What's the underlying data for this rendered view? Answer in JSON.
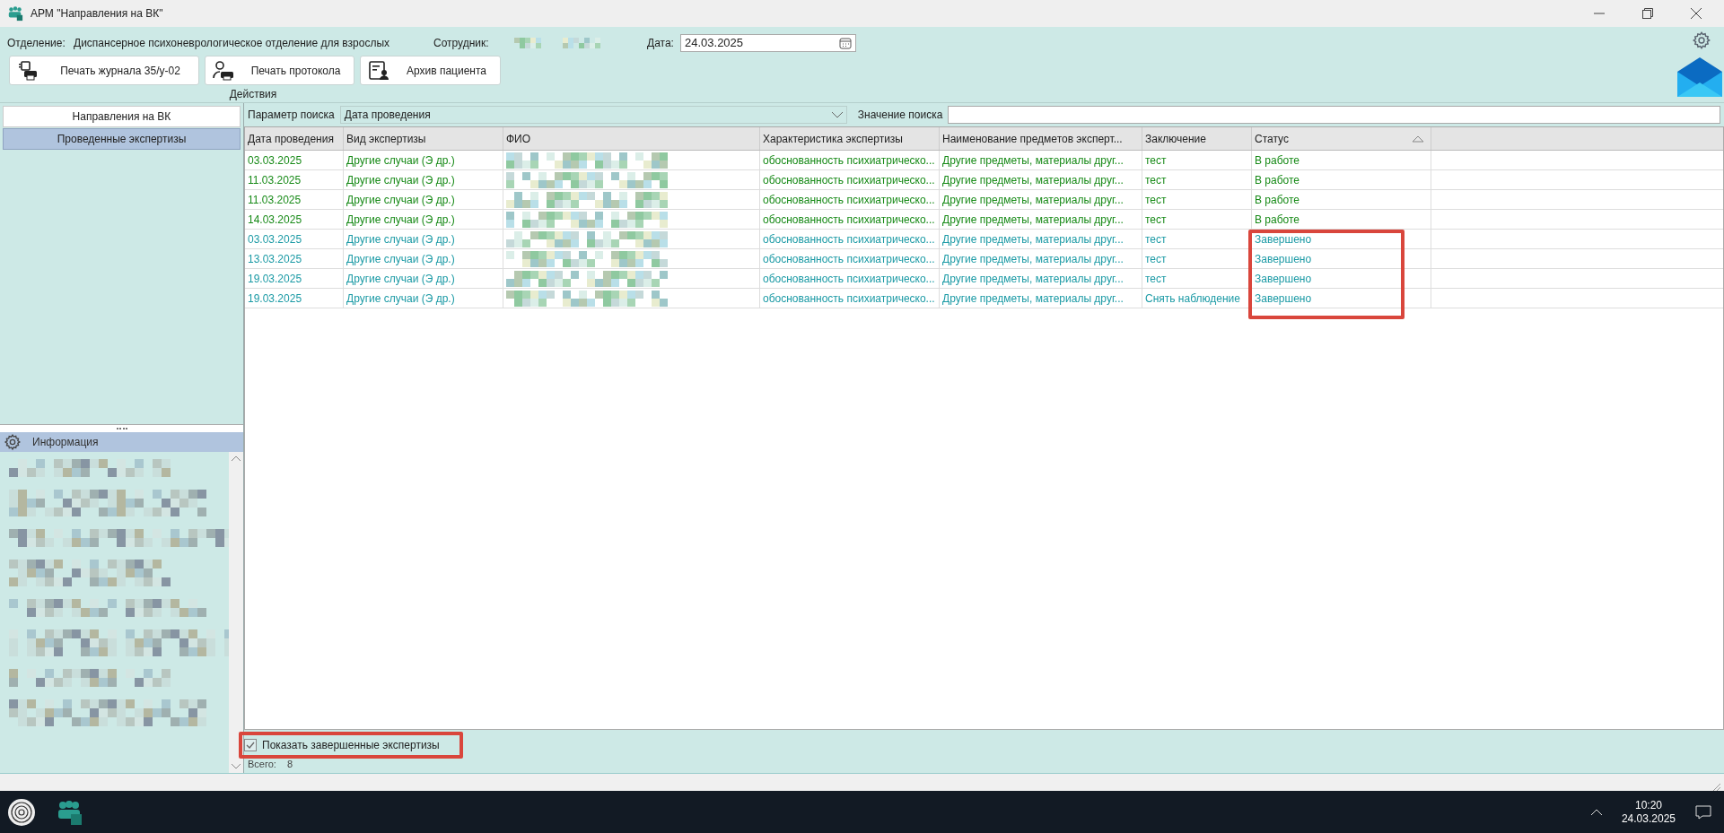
{
  "window": {
    "title": "АРМ \"Направления на ВК\""
  },
  "header": {
    "department_label": "Отделение:",
    "department": "Диспансерное психоневрологическое отделение для взрослых",
    "employee_label": "Сотрудник:",
    "date_label": "Дата:",
    "date": "24.03.2025"
  },
  "actions": {
    "buttons": [
      "Печать журнала 35/у-02",
      "Печать протокола",
      "Архив пациента"
    ],
    "group_label": "Действия"
  },
  "sidebar": {
    "tabs": [
      {
        "label": "Направления на ВК",
        "selected": false
      },
      {
        "label": "Проведенные экспертизы",
        "selected": true
      }
    ],
    "info_title": "Информация"
  },
  "search": {
    "param_label": "Параметр поиска",
    "param_value": "Дата проведения",
    "value_label": "Значение поиска"
  },
  "table": {
    "columns": [
      {
        "label": "Дата проведения",
        "sorted": false
      },
      {
        "label": "Вид экспертизы",
        "sorted": false
      },
      {
        "label": "ФИО",
        "sorted": false
      },
      {
        "label": "Характеристика экспертизы",
        "sorted": false
      },
      {
        "label": "Наименование предметов эксперт...",
        "sorted": false
      },
      {
        "label": "Заключение",
        "sorted": false
      },
      {
        "label": "Статус",
        "sorted": true
      }
    ],
    "rows": [
      {
        "completed": false,
        "highlighted": false,
        "cells": [
          "03.03.2025",
          "Другие случаи (Э др.)",
          "",
          "обоснованность психиатрическо...",
          "Другие предметы, материалы друг...",
          "тест",
          "В работе"
        ]
      },
      {
        "completed": false,
        "highlighted": false,
        "cells": [
          "11.03.2025",
          "Другие случаи (Э др.)",
          "",
          "обоснованность психиатрическо...",
          "Другие предметы, материалы друг...",
          "тест",
          "В работе"
        ]
      },
      {
        "completed": false,
        "highlighted": false,
        "cells": [
          "11.03.2025",
          "Другие случаи (Э др.)",
          "",
          "обоснованность психиатрическо...",
          "Другие предметы, материалы друг...",
          "тест",
          "В работе"
        ]
      },
      {
        "completed": false,
        "highlighted": false,
        "cells": [
          "14.03.2025",
          "Другие случаи (Э др.)",
          "",
          "обоснованность психиатрическо...",
          "Другие предметы, материалы друг...",
          "тест",
          "В работе"
        ]
      },
      {
        "completed": true,
        "highlighted": true,
        "cells": [
          "03.03.2025",
          "Другие случаи (Э др.)",
          "",
          "обоснованность психиатрическо...",
          "Другие предметы, материалы друг...",
          "тест",
          "Завершено"
        ]
      },
      {
        "completed": true,
        "highlighted": true,
        "cells": [
          "13.03.2025",
          "Другие случаи (Э др.)",
          "",
          "обоснованность психиатрическо...",
          "Другие предметы, материалы друг...",
          "тест",
          "Завершено"
        ]
      },
      {
        "completed": true,
        "highlighted": true,
        "cells": [
          "19.03.2025",
          "Другие случаи (Э др.)",
          "",
          "обоснованность психиатрическо...",
          "Другие предметы, материалы друг...",
          "тест",
          "Завершено"
        ]
      },
      {
        "completed": true,
        "highlighted": true,
        "cells": [
          "19.03.2025",
          "Другие случаи (Э др.)",
          "",
          "обоснованность психиатрическо...",
          "Другие предметы, материалы друг...",
          "Снять наблюдение",
          "Завершено"
        ]
      }
    ]
  },
  "footer": {
    "show_completed": {
      "label": "Показать завершенные экспертизы",
      "checked": true,
      "highlighted": true
    },
    "total_label": "Всего:",
    "total": "8"
  },
  "taskbar": {
    "time": "10:20",
    "date": "24.03.2025"
  }
}
